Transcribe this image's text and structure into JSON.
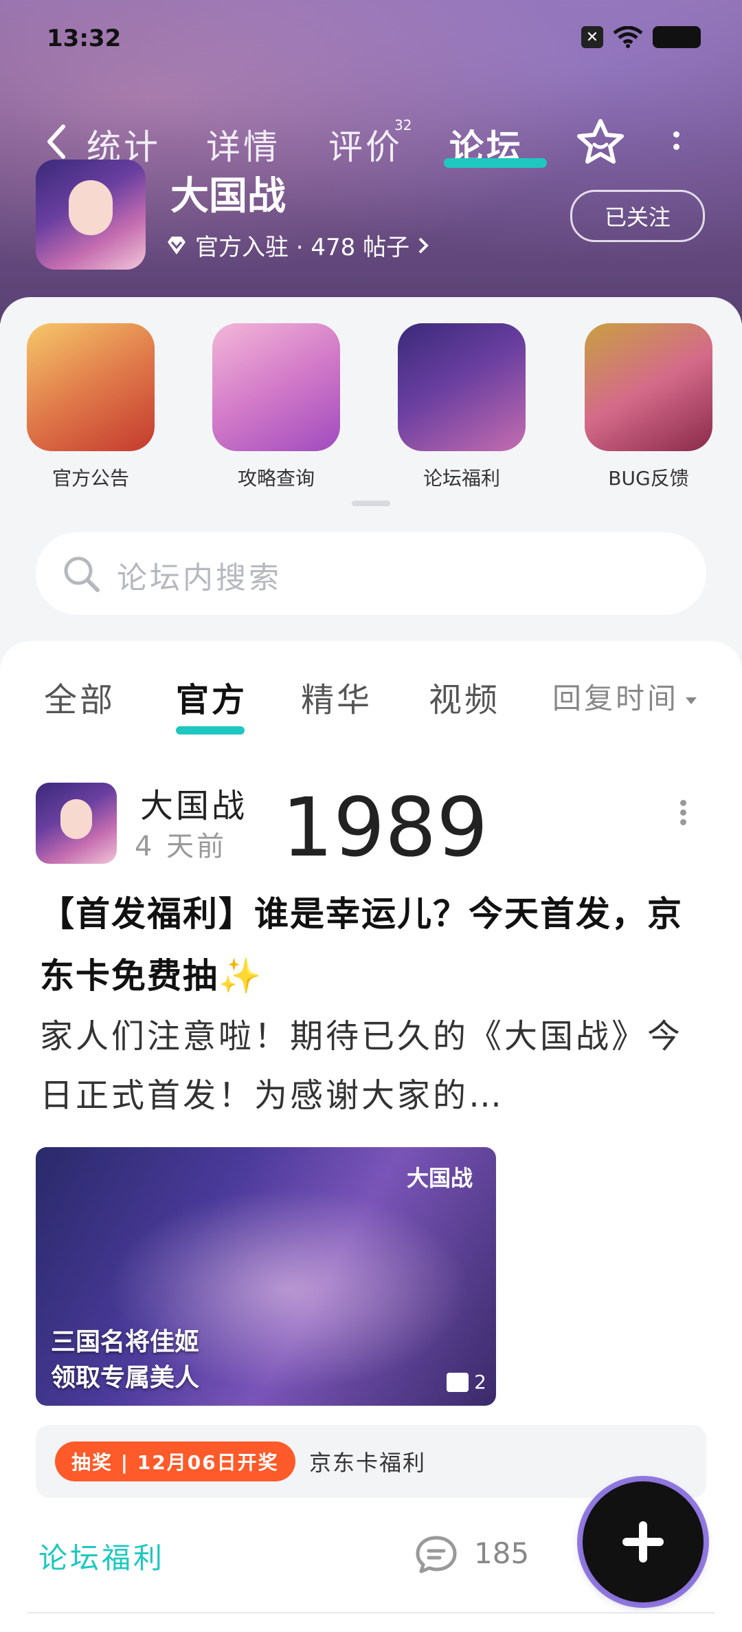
{
  "status_bar": {
    "time": "13:32"
  },
  "nav": {
    "tabs": [
      {
        "label": "统计"
      },
      {
        "label": "详情"
      },
      {
        "label": "评价",
        "badge": "32"
      },
      {
        "label": "论坛"
      }
    ],
    "active_tab": "论坛"
  },
  "game": {
    "name": "大国战",
    "meta": "官方入驻 · 478 帖子",
    "follow_label": "已关注"
  },
  "quick_entries": [
    {
      "label": "官方公告",
      "colors": [
        "#f6c86a",
        "#c43a2e"
      ]
    },
    {
      "label": "攻略查询",
      "colors": [
        "#f3b7d8",
        "#a04bbf"
      ]
    },
    {
      "label": "论坛福利",
      "colors": [
        "#3a2a7a",
        "#c56db0"
      ]
    },
    {
      "label": "BUG反馈",
      "colors": [
        "#c8a040",
        "#8a2a4a"
      ]
    }
  ],
  "search": {
    "placeholder": "论坛内搜索"
  },
  "sub_tabs": {
    "items": [
      {
        "label": "全部"
      },
      {
        "label": "官方"
      },
      {
        "label": "精华"
      },
      {
        "label": "视频"
      }
    ],
    "active": "官方",
    "sort_label": "回复时间"
  },
  "post": {
    "author": "大国战",
    "time_ago": "4 天前",
    "number": "1989",
    "title": "【首发福利】谁是幸运儿？今天首发，京东卡免费抽✨",
    "excerpt": "家人们注意啦！期待已久的《大国战》今日正式首发！为感谢大家的…",
    "banner_text_line1": "三国名将佳姬",
    "banner_text_line2": "领取专属美人",
    "banner_brand": "大国战",
    "image_count": "2",
    "lottery_tag": "抽奖 | 12月06日开奖",
    "lottery_text": "京东卡福利",
    "forum_tag": "论坛福利",
    "comment_count": "185"
  },
  "colors": {
    "accent": "#1ec8c0",
    "lottery": "#ff5a2a",
    "header_bg": "#6f5088"
  }
}
